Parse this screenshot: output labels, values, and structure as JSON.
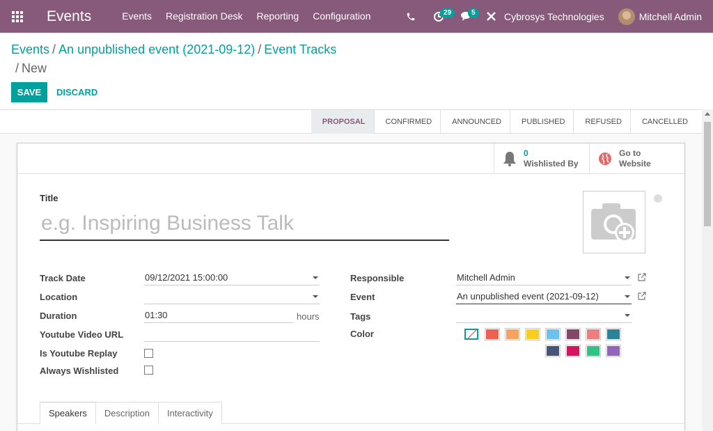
{
  "navbar": {
    "brand": "Events",
    "menu": [
      "Events",
      "Registration Desk",
      "Reporting",
      "Configuration"
    ],
    "activities_count": "29",
    "messages_count": "5",
    "company": "Cybrosys Technologies",
    "user": "Mitchell Admin",
    "color": "#875a7b"
  },
  "breadcrumb": {
    "items": [
      "Events",
      "An unpublished event (2021-09-12)",
      "Event Tracks"
    ],
    "current": "New"
  },
  "buttons": {
    "save": "SAVE",
    "discard": "DISCARD"
  },
  "stages": [
    "PROPOSAL",
    "CONFIRMED",
    "ANNOUNCED",
    "PUBLISHED",
    "REFUSED",
    "CANCELLED"
  ],
  "stat_buttons": {
    "wishlisted_count": "0",
    "wishlisted_label": "Wishlisted By",
    "website_line1": "Go to",
    "website_line2": "Website"
  },
  "form": {
    "title_label": "Title",
    "title_placeholder": "e.g. Inspiring Business Talk",
    "track_date_label": "Track Date",
    "track_date": "09/12/2021 15:00:00",
    "location_label": "Location",
    "location": "",
    "duration_label": "Duration",
    "duration": "01:30",
    "duration_unit": "hours",
    "youtube_label": "Youtube Video URL",
    "youtube": "",
    "replay_label": "Is Youtube Replay",
    "wishlisted_label": "Always Wishlisted",
    "responsible_label": "Responsible",
    "responsible": "Mitchell Admin",
    "event_label": "Event",
    "event": "An unpublished event (2021-09-12)",
    "tags_label": "Tags",
    "tags": "",
    "color_label": "Color"
  },
  "colors": [
    "#f06050",
    "#f4a460",
    "#f7cd1f",
    "#6cc1ed",
    "#814968",
    "#eb7e7f",
    "#2c8397",
    "#475577",
    "#d6145f",
    "#30c381",
    "#9365b8"
  ],
  "tabs": [
    "Speakers",
    "Description",
    "Interactivity"
  ]
}
